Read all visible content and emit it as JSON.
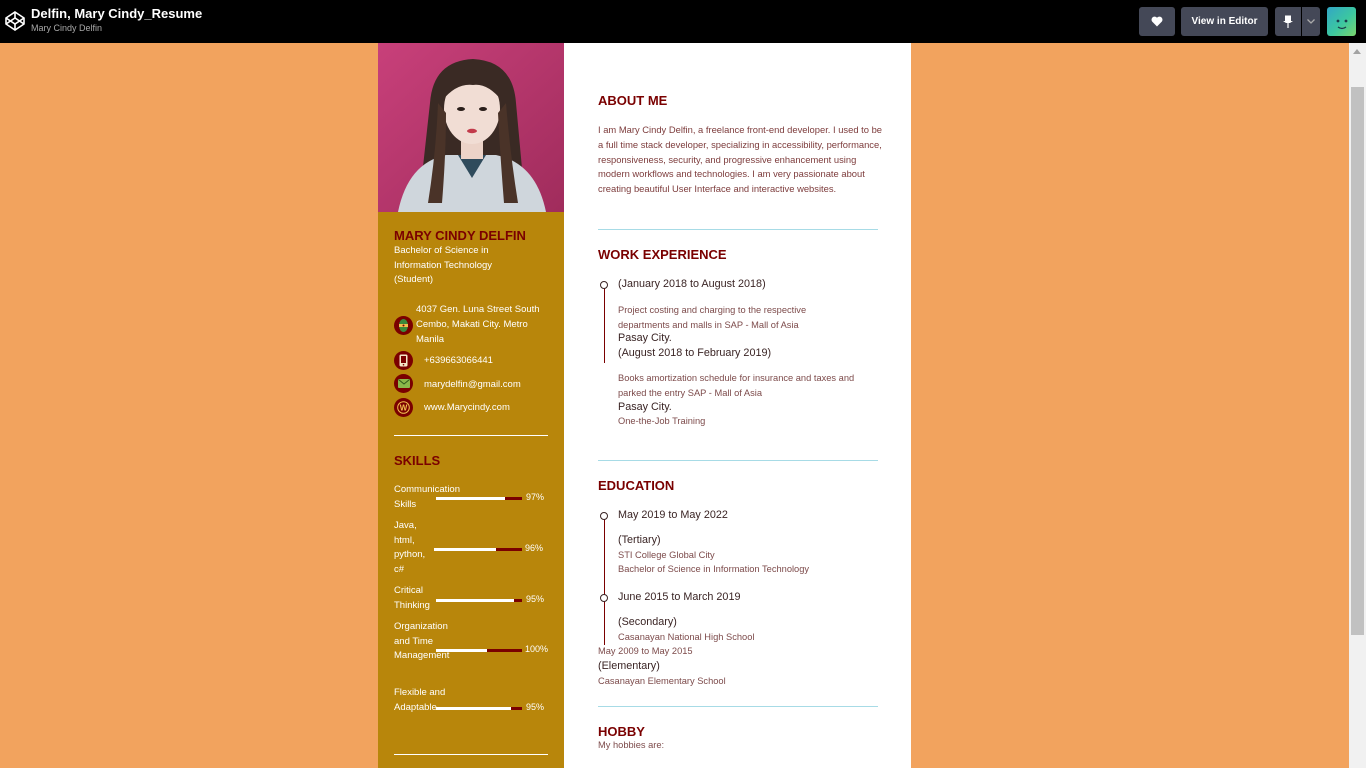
{
  "topbar": {
    "title": "Delfin, Mary Cindy_Resume",
    "author": "Mary Cindy Delfin",
    "heart_icon": "heart-icon",
    "view_in_editor": "View in Editor",
    "pin_icon": "pin-icon",
    "chevron_icon": "chevron-down-icon"
  },
  "profile": {
    "name": "MARY CINDY DELFIN",
    "degree": "Bachelor of Science in Information Technology (Student)",
    "address": "4037 Gen. Luna Street South Cembo, Makati City. Metro Manila",
    "phone": "+639663066441",
    "email": "marydelfin@gmail.com",
    "website": "www.Marycindy.com"
  },
  "skills": {
    "title": "SKILLS",
    "items": [
      {
        "label": "Communication Skills",
        "pct_text": "97%",
        "level": 0.8
      },
      {
        "label": "Java, html, python, c#",
        "pct_text": "96%",
        "level": 0.7
      },
      {
        "label": "Critical Thinking",
        "pct_text": "95%",
        "level": 0.91
      },
      {
        "label": "Organization and Time Management",
        "pct_text": "100%",
        "level": 0.59
      },
      {
        "label": "Flexible and Adaptable",
        "pct_text": "95%",
        "level": 0.87
      }
    ]
  },
  "about": {
    "title": "ABOUT ME",
    "text": "I am Mary Cindy Delfin, a freelance front-end developer. I used to be a full time stack developer, specializing in accessibility, performance, responsiveness, security, and progressive enhancement using modern workflows and technologies. I am very passionate about creating beautiful User Interface and interactive websites."
  },
  "work": {
    "title": "WORK EXPERIENCE",
    "date1": "(January 2018 to August 2018)",
    "desc1": "Project costing and charging to the respective departments and malls in SAP - Mall of Asia",
    "place1": "Pasay City.",
    "date2": "(August 2018 to February 2019)",
    "desc2": "Books amortization schedule for insurance and taxes and parked the entry SAP - Mall of Asia",
    "place2": "Pasay City.",
    "training": "One-the-Job Training"
  },
  "education": {
    "title": "EDUCATION",
    "date1": "May 2019 to May 2022",
    "level1": "(Tertiary)",
    "school1": "STI College Global City",
    "course1": "Bachelor of Science in Information Technology",
    "date2": "June 2015 to March 2019",
    "level2": "(Secondary)",
    "school2": "Casanayan National High School",
    "date3": "May 2009 to May 2015",
    "level3": "(Elementary)",
    "school3": "Casanayan Elementary School"
  },
  "hobby": {
    "title": "HOBBY",
    "text": "My hobbies are:"
  },
  "colors": {
    "page_bg": "#f2a35e",
    "sidebar_bg": "#b8860b",
    "accent": "#7a0000"
  }
}
